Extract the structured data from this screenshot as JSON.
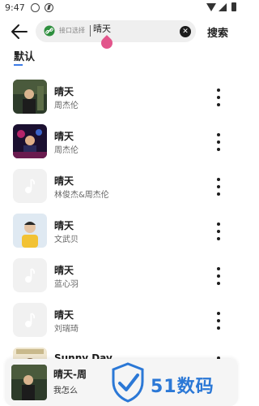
{
  "status_bar": {
    "time": "9:47"
  },
  "header": {
    "interface_label": "接口选择",
    "search_value": "晴天",
    "search_button": "搜索"
  },
  "tabs": [
    {
      "label": "默认",
      "active": true
    }
  ],
  "songs": [
    {
      "title": "晴天",
      "artist": "周杰伦",
      "cover": "art"
    },
    {
      "title": "晴天",
      "artist": "周杰伦",
      "cover": "art"
    },
    {
      "title": "晴天",
      "artist": "林俊杰&周杰伦",
      "cover": "placeholder"
    },
    {
      "title": "晴天",
      "artist": "文武贝",
      "cover": "art"
    },
    {
      "title": "晴天",
      "artist": "蓝心羽",
      "cover": "placeholder"
    },
    {
      "title": "晴天",
      "artist": "刘瑞琦",
      "cover": "placeholder"
    },
    {
      "title": "Sunny Day",
      "artist": "",
      "cover": "art"
    }
  ],
  "player": {
    "title": "晴天-周",
    "subtitle": "我怎么"
  },
  "watermark": {
    "text": "51数码"
  },
  "colors": {
    "accent": "#3e7ce6",
    "cursor": "#e2558b",
    "watermark": "#2b78d6"
  }
}
